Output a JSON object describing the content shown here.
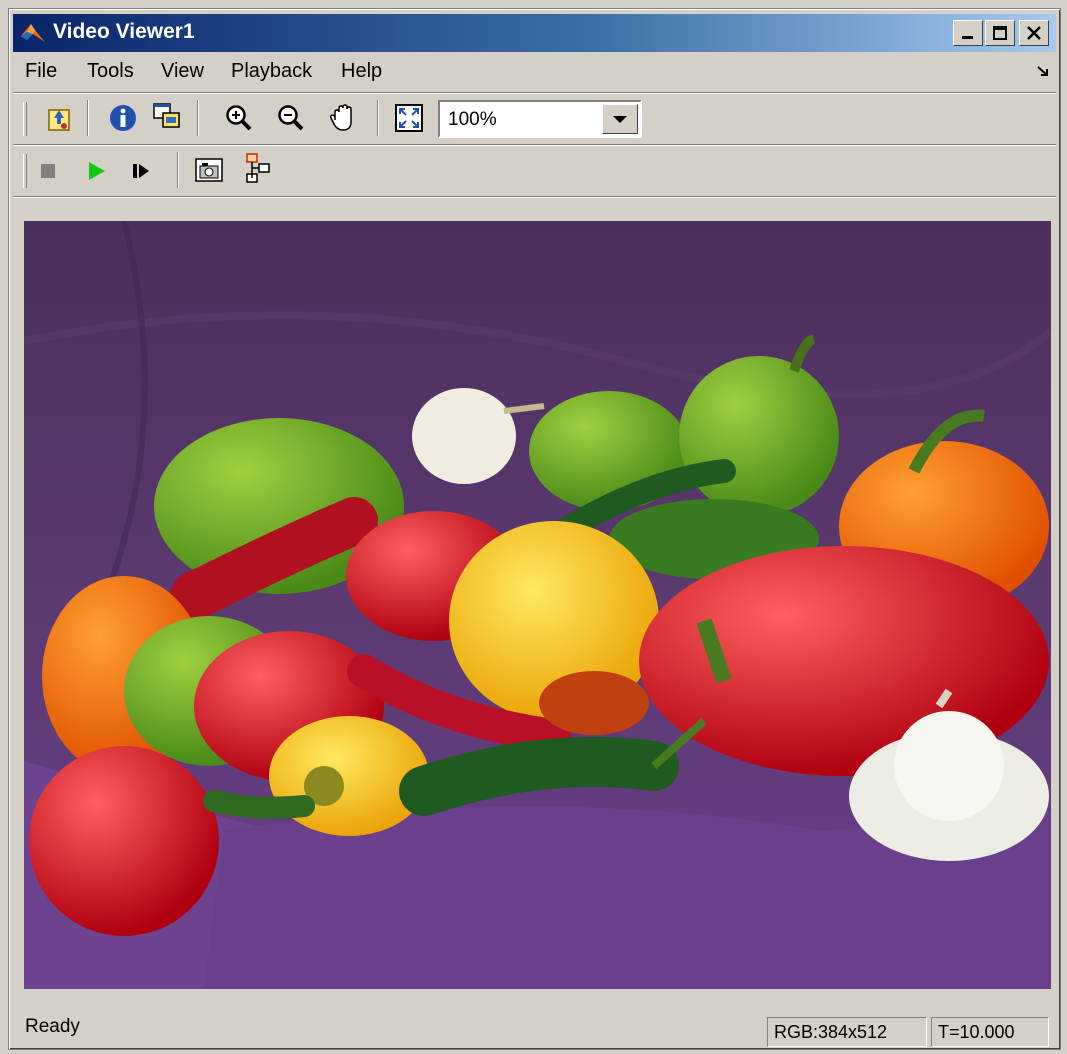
{
  "window": {
    "title": "Video Viewer1",
    "app_icon": "matlab-logo-icon"
  },
  "window_controls": {
    "minimize": "minimize-icon",
    "maximize": "maximize-icon",
    "close": "close-icon"
  },
  "menu": {
    "items": [
      "File",
      "Tools",
      "View",
      "Playback",
      "Help"
    ]
  },
  "toolbar1": {
    "buttons": [
      "new-source-icon",
      "info-icon",
      "copy-window-icon",
      "zoom-in-icon",
      "zoom-out-icon",
      "pan-hand-icon",
      "fit-to-window-icon"
    ],
    "zoom_value": "100%"
  },
  "toolbar2": {
    "buttons": [
      "stop-icon",
      "play-icon",
      "step-forward-icon",
      "snapshot-icon",
      "export-icon"
    ],
    "colors": {
      "stop": "#808080",
      "play": "#14c814"
    }
  },
  "viewport": {
    "content": "peppers image",
    "background_color": "#5b3a70"
  },
  "status": {
    "text": "Ready",
    "dimensions": "RGB:384x512",
    "time": "T=10.000"
  }
}
